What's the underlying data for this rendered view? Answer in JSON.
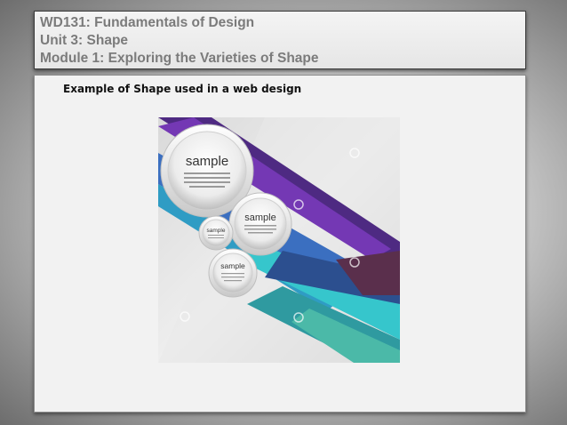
{
  "header": {
    "course": "WD131: Fundamentals of Design",
    "unit": "Unit 3: Shape",
    "module": "Module 1: Exploring the Varieties of Shape"
  },
  "content": {
    "caption": "Example of Shape used in a web design",
    "figure": {
      "bubbles": [
        {
          "label": "sample"
        },
        {
          "label": "sample"
        },
        {
          "label": "sample"
        },
        {
          "label": "sample"
        }
      ],
      "colors": {
        "purple": "#5a2a8c",
        "violet": "#6f3ab0",
        "blue": "#3f78c8",
        "cyan": "#36c4cc",
        "teal": "#2f9aa0",
        "maroon": "#5a2f4c"
      }
    }
  }
}
